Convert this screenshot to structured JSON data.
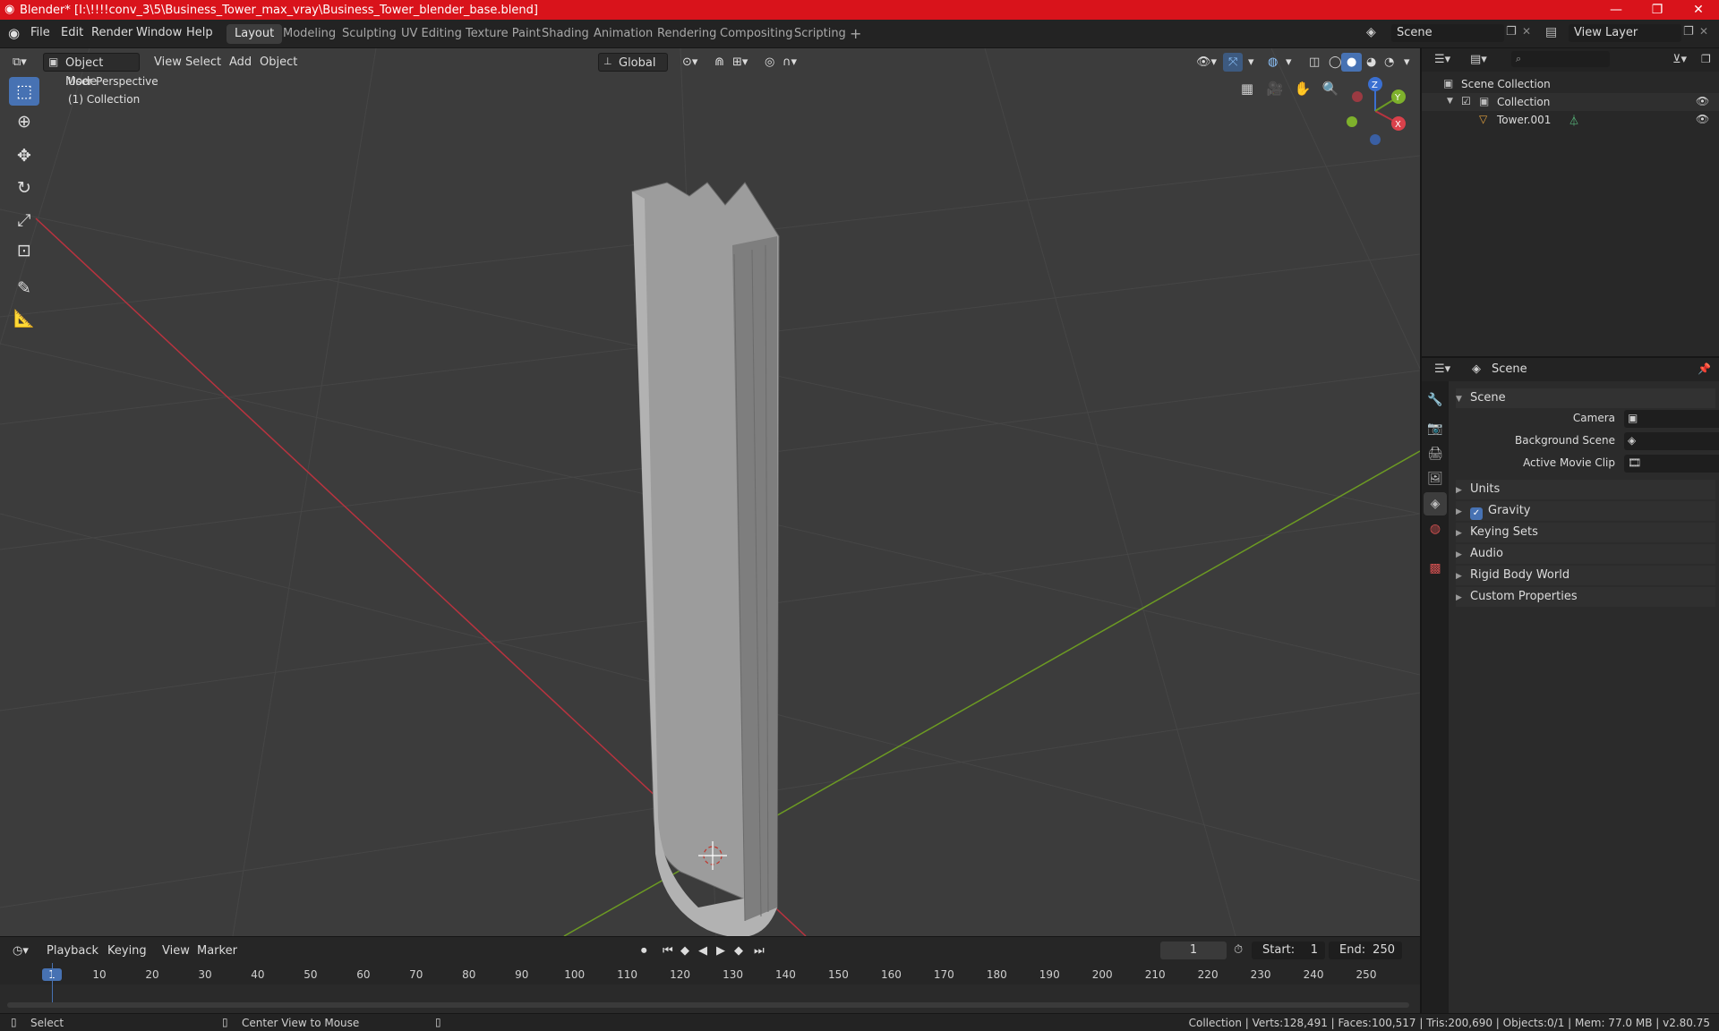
{
  "window": {
    "title": "Blender* [I:\\!!!!conv_3\\5\\Business_Tower_max_vray\\Business_Tower_blender_base.blend]",
    "minimize": "—",
    "maximize": "❐",
    "close": "✕"
  },
  "menu": [
    "File",
    "Edit",
    "Render",
    "Window",
    "Help"
  ],
  "workspaces": [
    "Layout",
    "Modeling",
    "Sculpting",
    "UV Editing",
    "Texture Paint",
    "Shading",
    "Animation",
    "Rendering",
    "Compositing",
    "Scripting"
  ],
  "active_workspace": "Layout",
  "add_workspace": "+",
  "scene": {
    "name": "Scene",
    "view_layer": "View Layer"
  },
  "viewport": {
    "mode": "Object Mode",
    "menus": [
      "View",
      "Select",
      "Add",
      "Object"
    ],
    "orientation": "Global",
    "perspective": "User Perspective",
    "collection": "(1) Collection",
    "gizmo_axes": {
      "x": "X",
      "y": "Y",
      "z": "Z"
    },
    "object": {
      "name": "Tower.001"
    }
  },
  "toolbar": [
    "select-box-icon",
    "cursor-icon",
    "move-icon",
    "rotate-icon",
    "scale-icon",
    "transform-icon",
    "annotate-icon",
    "measure-icon"
  ],
  "outliner": {
    "root": "Scene Collection",
    "collection": "Collection",
    "object": "Tower.001"
  },
  "properties": {
    "context": "Scene",
    "panel": "Scene",
    "fields": [
      {
        "label": "Camera",
        "value": ""
      },
      {
        "label": "Background Scene",
        "value": ""
      },
      {
        "label": "Active Movie Clip",
        "value": ""
      }
    ],
    "subpanels": [
      {
        "label": "Units",
        "checkbox": false
      },
      {
        "label": "Gravity",
        "checkbox": true
      },
      {
        "label": "Keying Sets",
        "checkbox": false
      },
      {
        "label": "Audio",
        "checkbox": false
      },
      {
        "label": "Rigid Body World",
        "checkbox": false
      },
      {
        "label": "Custom Properties",
        "checkbox": false
      }
    ]
  },
  "timeline": {
    "menus": [
      "Playback",
      "Keying",
      "View",
      "Marker"
    ],
    "current_frame": "1",
    "start_label": "Start:",
    "start": "1",
    "end_label": "End:",
    "end": "250",
    "ticks": [
      "1",
      "10",
      "20",
      "30",
      "40",
      "50",
      "60",
      "70",
      "80",
      "90",
      "100",
      "110",
      "120",
      "130",
      "140",
      "150",
      "160",
      "170",
      "180",
      "190",
      "200",
      "210",
      "220",
      "230",
      "240",
      "250"
    ]
  },
  "status": {
    "left": "Select",
    "middle": "Center View to Mouse",
    "right": "Collection | Verts:128,491 | Faces:100,517 | Tris:200,690 | Objects:0/1 | Mem: 77.0 MB | v2.80.75"
  },
  "colors": {
    "title_bar": "#d9131b",
    "accent": "#4772b3",
    "x_axis": "#b8333f",
    "y_axis": "#6c9a23",
    "viewport_bg": "#3c3c3c"
  }
}
